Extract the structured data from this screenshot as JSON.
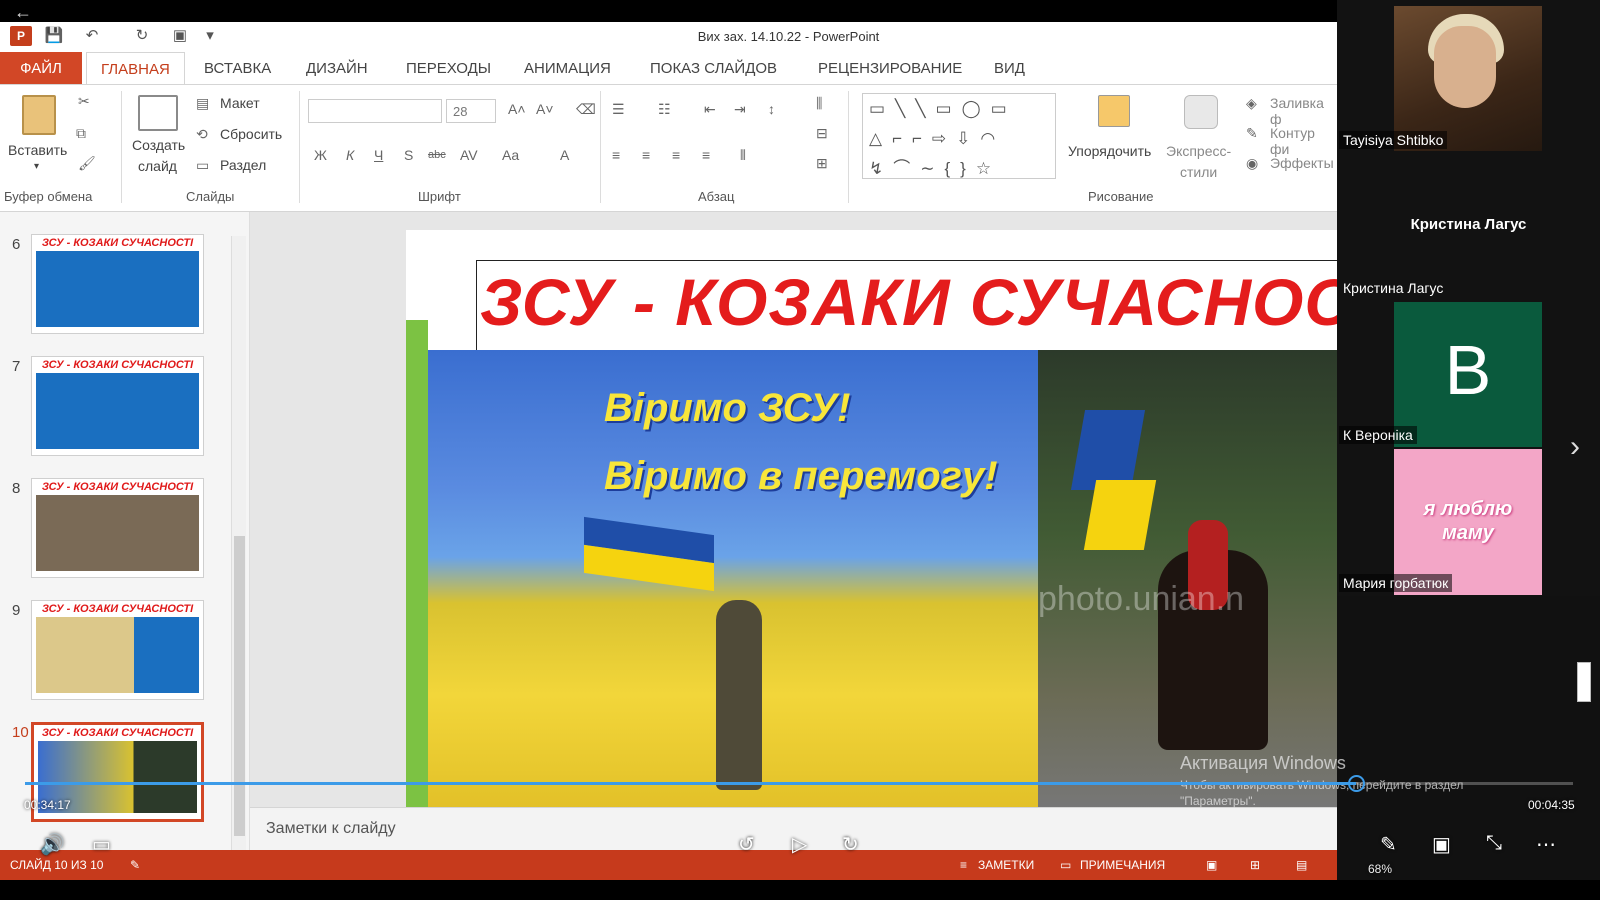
{
  "window": {
    "title": "Вих зах. 14.10.22 - PowerPoint"
  },
  "tabs": [
    {
      "label": "ФАЙЛ"
    },
    {
      "label": "ГЛАВНАЯ"
    },
    {
      "label": "ВСТАВКА"
    },
    {
      "label": "ДИЗАЙН"
    },
    {
      "label": "ПЕРЕХОДЫ"
    },
    {
      "label": "АНИМАЦИЯ"
    },
    {
      "label": "ПОКАЗ СЛАЙДОВ"
    },
    {
      "label": "РЕЦЕНЗИРОВАНИЕ"
    },
    {
      "label": "ВИД"
    }
  ],
  "ribbon": {
    "paste": "Вставить",
    "new_slide_1": "Создать",
    "new_slide_2": "слайд",
    "layout": "Макет",
    "reset": "Сбросить",
    "section": "Раздел",
    "font_size": "28",
    "arrange": "Упорядочить",
    "quick_styles_1": "Экспресс-",
    "quick_styles_2": "стили",
    "fill": "Заливка ф",
    "outline": "Контур фи",
    "effects": "Эффекты",
    "groups": {
      "clipboard": "Буфер обмена",
      "slides": "Слайды",
      "font": "Шрифт",
      "paragraph": "Абзац",
      "drawing": "Рисование"
    },
    "font_buttons": [
      "Ж",
      "К",
      "Ч",
      "S",
      "abc",
      "Aa",
      "A"
    ]
  },
  "thumbnails": [
    {
      "num": "6",
      "title": "ЗСУ - КОЗАКИ СУЧАСНОСТІ"
    },
    {
      "num": "7",
      "title": "ЗСУ - КОЗАКИ СУЧАСНОСТІ"
    },
    {
      "num": "8",
      "title": "ЗСУ - КОЗАКИ СУЧАСНОСТІ"
    },
    {
      "num": "9",
      "title": "ЗСУ - КОЗАКИ СУЧАСНОСТІ"
    },
    {
      "num": "10",
      "title": "ЗСУ - КОЗАКИ СУЧАСНОСТІ"
    }
  ],
  "slide": {
    "title": "ЗСУ - КОЗАКИ СУЧАСНОСТІ",
    "image_text_1": "Віримо ЗСУ!",
    "image_text_2": "Віримо в перемогу!",
    "photo_watermark": "photo.unian.n"
  },
  "notes_placeholder": "Заметки к слайду",
  "status": {
    "slide_counter": "СЛАЙД 10 ИЗ 10",
    "notes": "ЗАМЕТКИ",
    "comments": "ПРИМЕЧАНИЯ",
    "zoom": "68%"
  },
  "activation": {
    "line1": "Активация Windows",
    "line2": "Чтобы активировать Windows, перейдите в раздел",
    "line3": "\"Параметры\"."
  },
  "participants": [
    {
      "name": "Tayisiya Shtibko"
    },
    {
      "name": "Кристина Лагус",
      "display": "Кристина Лагус"
    },
    {
      "name": "К Вероніка",
      "avatar_letter": "В"
    },
    {
      "name": "Мария горбатюк",
      "tile_text_1": "я люблю",
      "tile_text_2": "маму"
    }
  ],
  "player": {
    "current_time": "00:34:17",
    "total_time": "00:04:35",
    "progress": 0.86,
    "accent": "#3c9be8"
  },
  "colors": {
    "ppt_accent": "#d24726",
    "slide_title": "#e41c1c"
  }
}
